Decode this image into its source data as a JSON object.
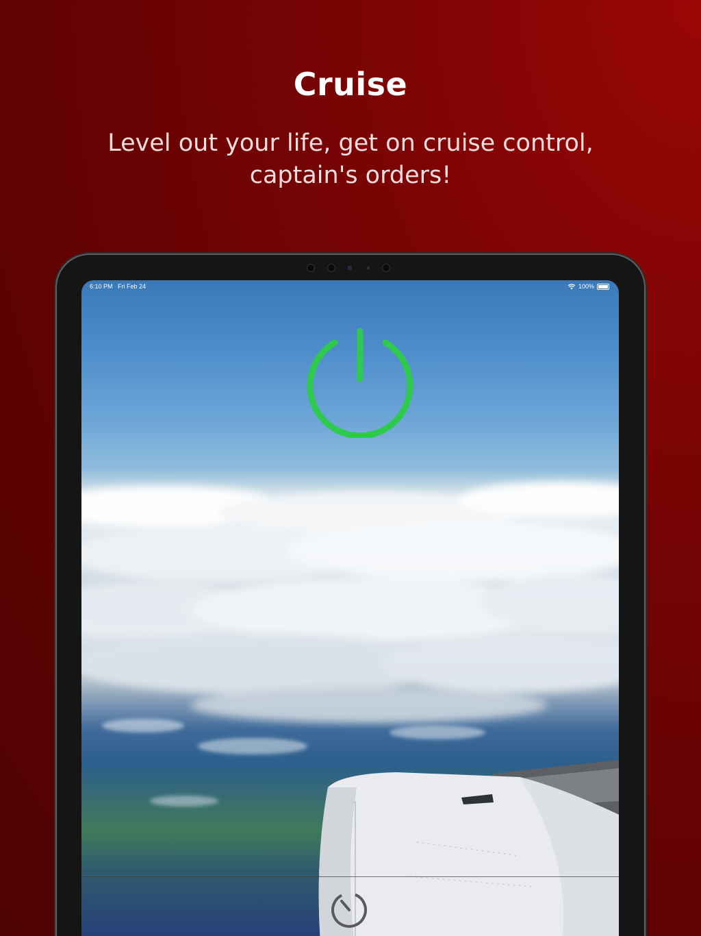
{
  "promo": {
    "title": "Cruise",
    "subtitle": "Level out your life, get on cruise control,\ncaptain's orders!"
  },
  "device": {
    "status_bar": {
      "time": "6:10 PM",
      "date": "Fri Feb 24",
      "battery": "100%"
    },
    "icons": {
      "power": "power-icon",
      "timer": "timer-icon",
      "wifi": "wifi-icon",
      "battery": "battery-icon"
    }
  },
  "colors": {
    "background": "#7a0404",
    "power_accent": "#2ec94d",
    "timer_icon": "#5a5a5a"
  }
}
